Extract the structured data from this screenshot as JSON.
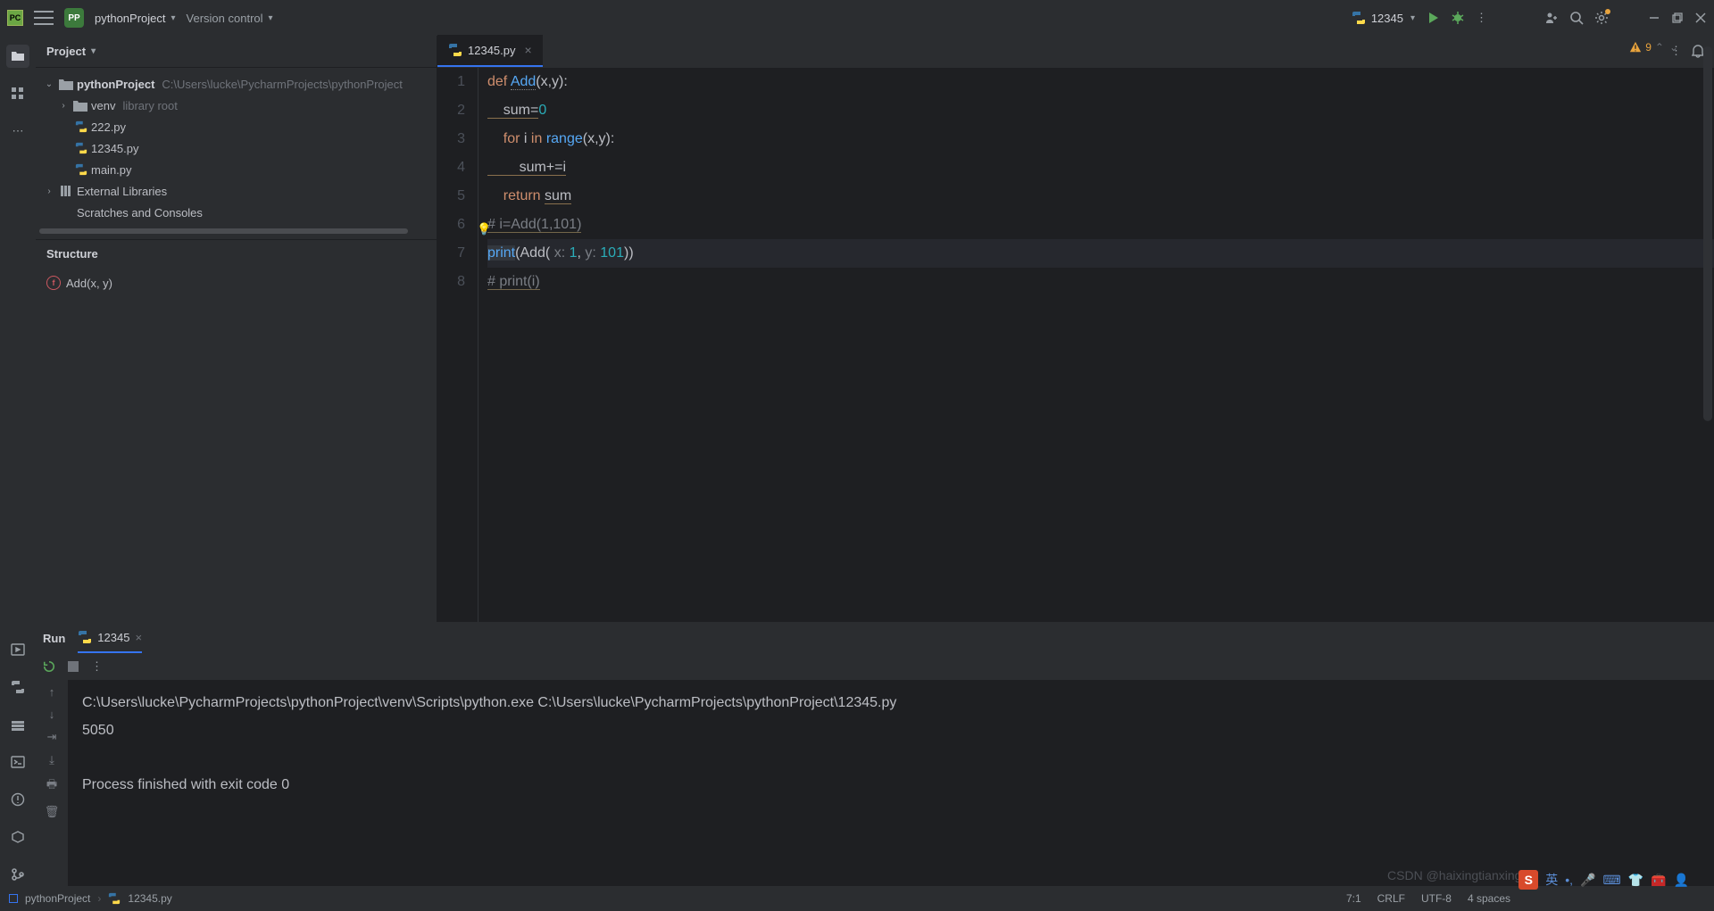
{
  "topbar": {
    "project_name": "pythonProject",
    "version_control": "Version control",
    "run_config": "12345"
  },
  "sidebar": {
    "header": "Project",
    "tree": {
      "root": "pythonProject",
      "root_path": "C:\\Users\\lucke\\PycharmProjects\\pythonProject",
      "venv": "venv",
      "venv_hint": "library root",
      "files": [
        "222.py",
        "12345.py",
        "main.py"
      ],
      "ext": "External Libraries",
      "scratch": "Scratches and Consoles"
    },
    "structure_header": "Structure",
    "structure_item": "Add(x, y)"
  },
  "editor": {
    "tab_name": "12345.py",
    "warning_count": "9",
    "lines": [
      "1",
      "2",
      "3",
      "4",
      "5",
      "6",
      "7",
      "8"
    ]
  },
  "code": {
    "l1_def": "def ",
    "l1_fn": "Add",
    "l1_rest": "(x,y):",
    "l2_a": "    sum=",
    "l2_b": "0",
    "l3_a": "    ",
    "l3_for": "for ",
    "l3_i": "i ",
    "l3_in": "in ",
    "l3_range": "range",
    "l3_rest": "(x,y):",
    "l4": "        sum+=i",
    "l5_a": "    ",
    "l5_ret": "return ",
    "l5_sum": "sum",
    "l6": "# i=Add(1,101)",
    "l7_print": "print",
    "l7_a": "(",
    "l7_add": "Add",
    "l7_b": "( ",
    "l7_hx": "x: ",
    "l7_1": "1",
    "l7_c": ", ",
    "l7_hy": "y: ",
    "l7_101": "101",
    "l7_d": "))",
    "l8": "# print(i)"
  },
  "run": {
    "title": "Run",
    "tab": "12345",
    "out_cmd": "C:\\Users\\lucke\\PycharmProjects\\pythonProject\\venv\\Scripts\\python.exe C:\\Users\\lucke\\PycharmProjects\\pythonProject\\12345.py",
    "out_result": "5050",
    "out_exit": "Process finished with exit code 0"
  },
  "status": {
    "crumb1": "pythonProject",
    "crumb2": "12345.py",
    "pos": "7:1",
    "eol": "CRLF",
    "enc": "UTF-8",
    "indent": "4 spaces"
  },
  "watermark": "CSDN @haixingtianxingha",
  "ime_lang": "英"
}
